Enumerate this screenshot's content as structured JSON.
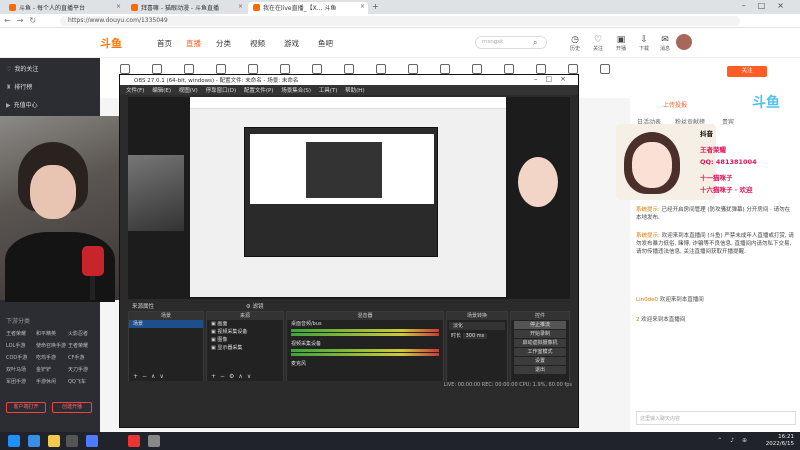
{
  "browser": {
    "tabs": [
      {
        "label": "斗鱼 - 每个人的直播平台"
      },
      {
        "label": "拜喜嘛 - 猫眼动漫 - 斗鱼直播"
      },
      {
        "label": "我在在live直播_【X... 斗鱼"
      }
    ],
    "url": "https://www.douyu.com/1335049"
  },
  "header": {
    "logo": "斗鱼",
    "nav": [
      "首页",
      "直播",
      "分类",
      "视频",
      "游戏",
      "鱼吧"
    ],
    "active_nav": "直播",
    "search_placeholder": "msngsk",
    "icons": [
      {
        "name": "history-icon",
        "label": "历史"
      },
      {
        "name": "follow-icon",
        "label": "关注"
      },
      {
        "name": "gift-icon",
        "label": "开播"
      },
      {
        "name": "download-icon",
        "label": "下载"
      },
      {
        "name": "message-icon",
        "label": "消息"
      }
    ]
  },
  "sidebar": {
    "items": [
      {
        "icon": "heart-icon",
        "label": "我的关注"
      },
      {
        "icon": "trophy-icon",
        "label": "排行榜"
      },
      {
        "icon": "video-icon",
        "label": "充值中心"
      }
    ],
    "section": "下游分类",
    "grid": [
      [
        "王者荣耀",
        "和平精英",
        "火影忍者"
      ],
      [
        "LOL手游",
        "使命召唤手游",
        "王者荣耀"
      ],
      [
        "COD手游",
        "吃鸡手游",
        "CF手游"
      ],
      [
        "双叶马场",
        "金铲铲",
        "天刀手游"
      ],
      [
        "军团手游",
        "手游休闲",
        "QQ飞车"
      ]
    ],
    "buttons": [
      "客户端打开",
      "创建开播"
    ]
  },
  "obs": {
    "title": "OBS 27.0.1 (64-bit, windows) - 配置文件: 未命名 - 场景: 未命名",
    "menu": [
      "文件(F)",
      "编辑(E)",
      "视图(V)",
      "停靠窗口(D)",
      "配置文件(P)",
      "场景集合(S)",
      "工具(T)",
      "帮助(H)"
    ],
    "tabs_bar": "来源属性",
    "filter_btn": "滤镜",
    "docks": {
      "scenes": {
        "title": "场景",
        "items": [
          "场景"
        ]
      },
      "sources": {
        "title": "来源",
        "items": [
          "画面",
          "视频采集设备",
          "图像",
          "显示器采集"
        ]
      },
      "mixer": {
        "title": "混音器",
        "channels": [
          "桌面音频/bus",
          "视频采集设备",
          "麦克风"
        ]
      },
      "transitions": {
        "title": "场景转换",
        "type": "淡化",
        "duration_label": "时长",
        "duration": "300 ms"
      },
      "controls": {
        "title": "控件",
        "buttons": [
          "停止推流",
          "开始录制",
          "启动虚拟摄像机",
          "工作室模式",
          "设置",
          "退出"
        ]
      }
    },
    "status": "LIVE: 00:00:00  REC: 00:00:00  CPU: 1.9%, 60.00 fps"
  },
  "right": {
    "anchor_name": "上传投报",
    "follow_btn": "关注",
    "tabs": [
      "日活动表",
      "粉丝贡献榜",
      "贵宾"
    ],
    "promo": {
      "tiktok": "抖音",
      "lines": [
        "王者荣耀",
        "QQ: 481381004",
        "十一猫咪子",
        "十六猫咪子 · 欢迎"
      ]
    },
    "chat": [
      {
        "name": "系统提示:",
        "text": "已经开启房间管理 (防攻骚扰弹幕) 分开房间 · 请勿在本地发布."
      },
      {
        "name": "系统提示:",
        "text": "欢迎来到本直播间 (斗鱼) 严禁未成年人直播或打赏, 请勿发布暴力低俗, 赌博, 诈骗等不良信息, 直播间内请勿私下交易, 请勿传播违法信息, 关注直播间获取开播提醒."
      },
      {
        "name": "Lin0de0",
        "text": "欢迎来到本直播间"
      },
      {
        "name": "2",
        "text": "欢迎来到本直播间"
      }
    ],
    "input_placeholder": "这里输入聊天内容"
  },
  "taskbar": {
    "time": "16:21",
    "date": "2022/6/15"
  },
  "colors": {
    "accent": "#ff5d23",
    "obs_bg": "#2b2b2b",
    "sidebar_bg": "#2b2d33"
  }
}
